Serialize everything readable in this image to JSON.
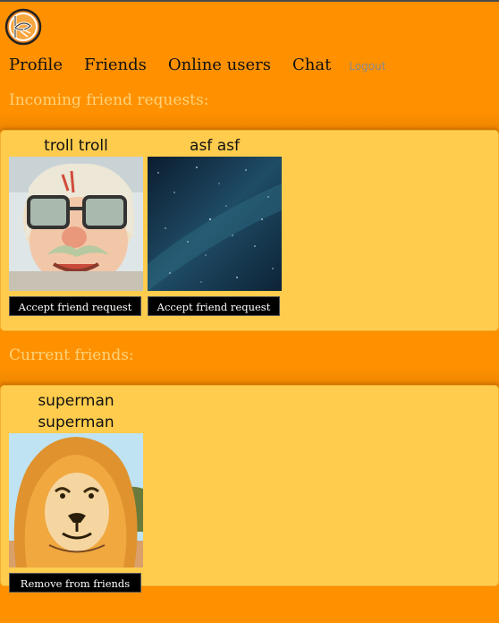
{
  "nav": {
    "profile": "Profile",
    "friends": "Friends",
    "online_users": "Online users",
    "chat": "Chat",
    "logout": "Logout"
  },
  "incoming": {
    "title": "Incoming friend requests:",
    "requests": [
      {
        "name": "troll troll",
        "button": "Accept friend request",
        "photo": "cartoon-old-man-glasses"
      },
      {
        "name": "asf asf",
        "button": "Accept friend request",
        "photo": "starry-night-sky"
      }
    ]
  },
  "friends": {
    "title": "Current friends:",
    "list": [
      {
        "name": "superman superman",
        "button": "Remove from friends",
        "photo": "cartoon-lion"
      }
    ]
  },
  "colors": {
    "background": "#ff9100",
    "panel": "#ffcc4d",
    "section_title": "#ffd27a",
    "button": "#000000"
  }
}
